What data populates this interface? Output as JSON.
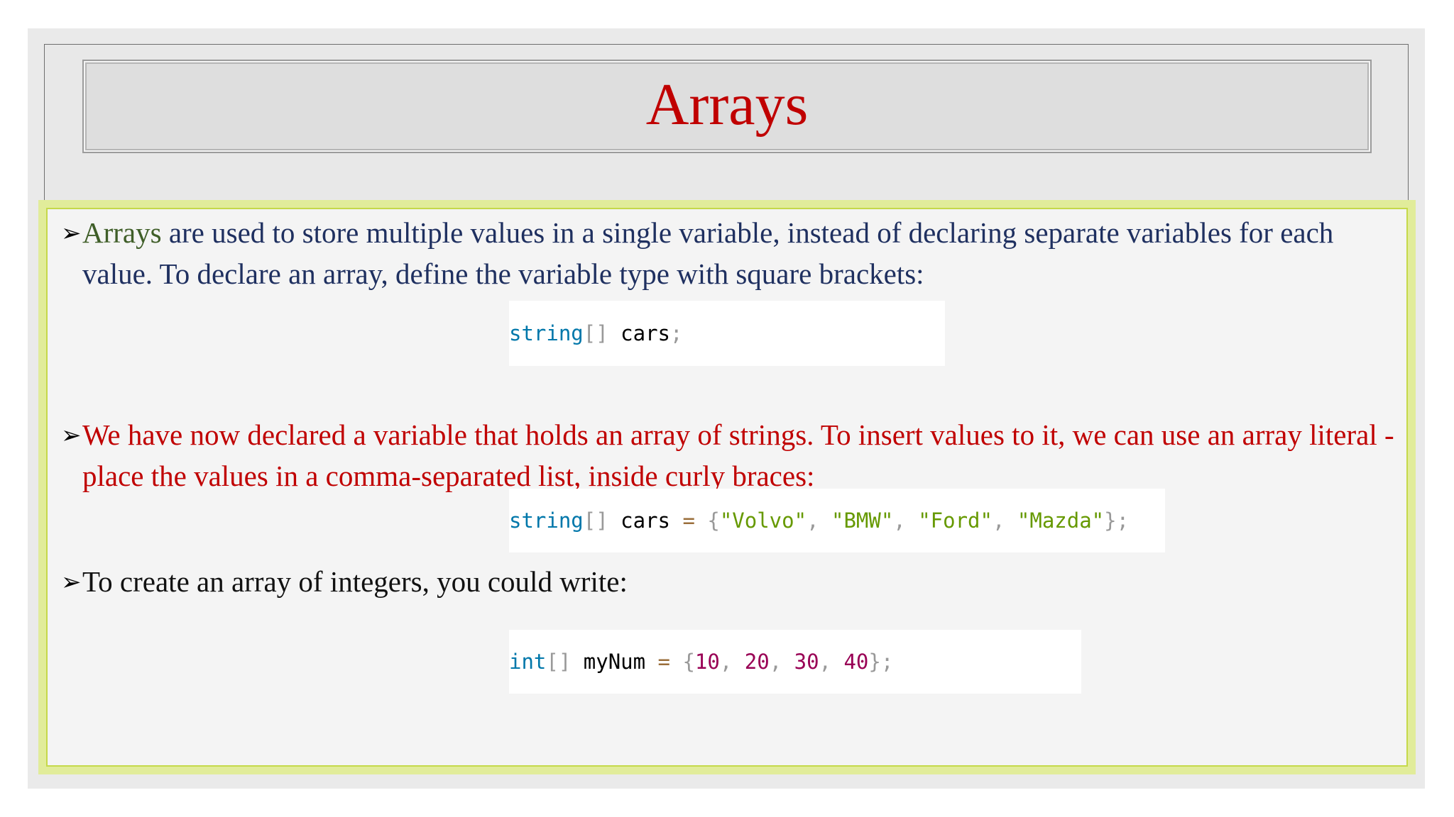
{
  "slide": {
    "title": "Arrays",
    "colors": {
      "title": "#c00000",
      "body_blue": "#1f3060",
      "keyword_green": "#3f5e28",
      "body_red": "#c00000",
      "body_black": "#111111",
      "content_border": "#e1ec9a"
    }
  },
  "paragraphs": [
    {
      "bullet": "➢",
      "highlight": "Arrays",
      "text": " are used to store multiple values in a single variable, instead of declaring separate variables for each value. To declare an array, define the variable type with square brackets:"
    },
    {
      "bullet": "➢",
      "text": "We have now declared a variable that holds an array of strings. To insert values to it, we can use an array literal - place the values in a comma-separated list, inside curly braces:"
    },
    {
      "bullet": "➢",
      "text": "To create an array of integers, you could write:"
    }
  ],
  "code": {
    "snippet1": {
      "type": "string",
      "brackets": "[]",
      "name": " cars",
      "semi": ";"
    },
    "snippet2": {
      "type": "string",
      "brackets": "[]",
      "name": " cars ",
      "eq": "=",
      "open": " {",
      "v1": "\"Volvo\"",
      "c1": ", ",
      "v2": "\"BMW\"",
      "c2": ", ",
      "v3": "\"Ford\"",
      "c3": ", ",
      "v4": "\"Mazda\"",
      "close": "};"
    },
    "snippet3": {
      "type": "int",
      "brackets": "[]",
      "name": " myNum ",
      "eq": "=",
      "open": " {",
      "n1": "10",
      "c1": ", ",
      "n2": "20",
      "c2": ", ",
      "n3": "30",
      "c3": ", ",
      "n4": "40",
      "close": "};"
    }
  }
}
